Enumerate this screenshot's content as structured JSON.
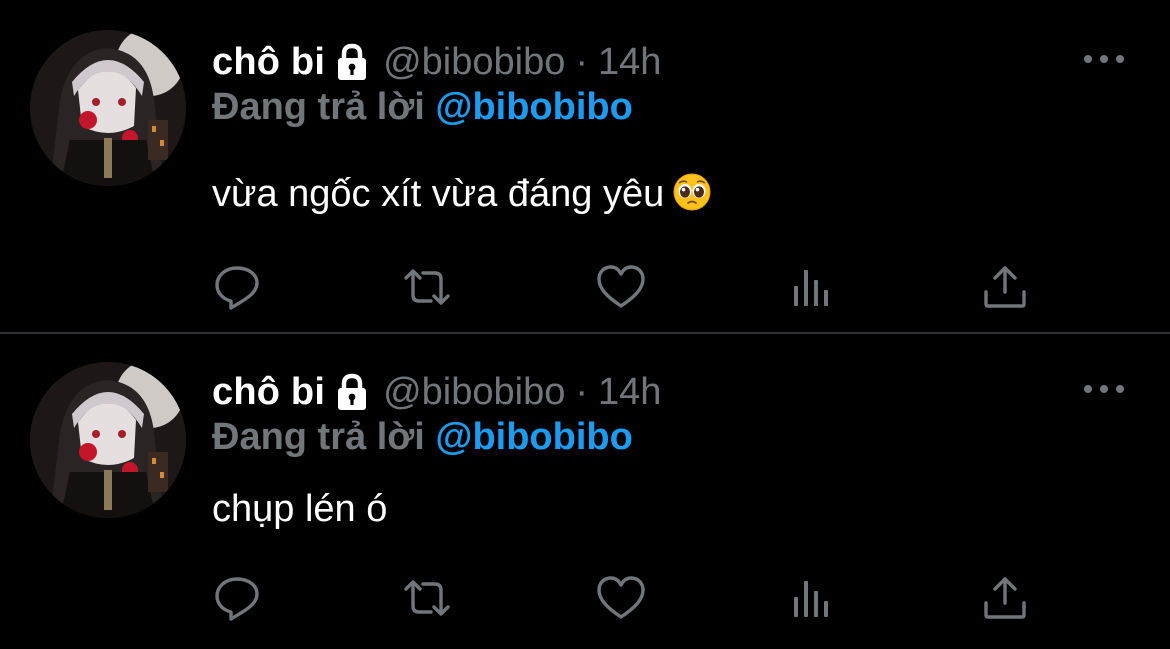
{
  "tweets": [
    {
      "display_name": "chô bi",
      "handle": "@bibobibo",
      "separator": "·",
      "time": "14h",
      "reply_prefix": "Đang trả lời",
      "reply_to": "@bibobibo",
      "text": "vừa ngốc xít vừa đáng yêu",
      "emoji": "pleading-face-emoji"
    },
    {
      "display_name": "chô bi",
      "handle": "@bibobibo",
      "separator": "·",
      "time": "14h",
      "reply_prefix": "Đang trả lời",
      "reply_to": "@bibobibo",
      "text": "chụp lén ó"
    }
  ],
  "icons": {
    "lock": "lock-icon",
    "more": "more-icon",
    "reply": "reply-icon",
    "retweet": "retweet-icon",
    "like": "heart-icon",
    "views": "views-icon",
    "share": "share-icon"
  },
  "colors": {
    "background": "#000000",
    "name": "#ffffff",
    "muted": "#71767b",
    "mention": "#1d9bf0",
    "divider": "#2f3336"
  }
}
